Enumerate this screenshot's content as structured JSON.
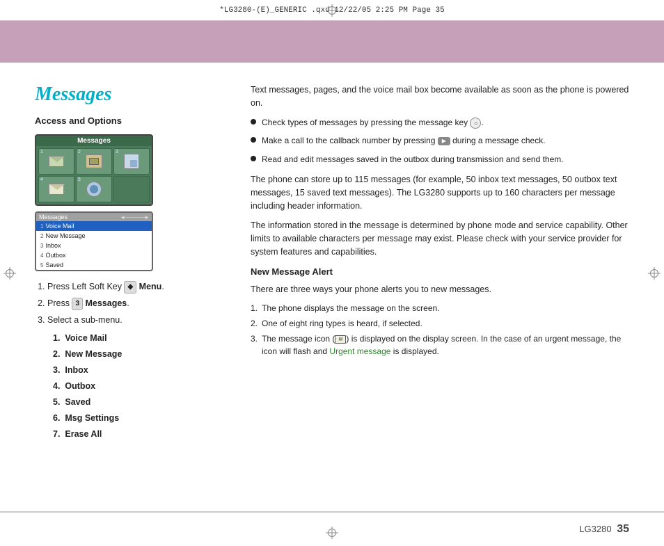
{
  "print_header": {
    "text": "*LG3280-(E)_GENERIC .qxd   12/22/05   2:25 PM   Page 35"
  },
  "color_band": {
    "color": "#c6a0b8"
  },
  "left_col": {
    "section_title": "Messages",
    "access_options_title": "Access and Options",
    "phone_top": {
      "header": "Messages",
      "cells": [
        {
          "num": "1",
          "type": "icon"
        },
        {
          "num": "2",
          "type": "icon"
        },
        {
          "num": "3",
          "type": "icon"
        },
        {
          "num": "4",
          "type": "icon"
        },
        {
          "num": "5",
          "type": "icon"
        }
      ]
    },
    "phone_bottom": {
      "header": "Messages",
      "menu_items": [
        {
          "num": "1",
          "label": "Voice Mail",
          "selected": true
        },
        {
          "num": "2",
          "label": "New Message"
        },
        {
          "num": "3",
          "label": "Inbox"
        },
        {
          "num": "4",
          "label": "Outbox"
        },
        {
          "num": "5",
          "label": "Saved"
        }
      ]
    },
    "steps": {
      "step1": "Press Left Soft Key",
      "step1_key": "Menu",
      "step2": "Press",
      "step2_key": "3",
      "step2_label": "Messages",
      "step3": "Select a sub-menu.",
      "sub_items": [
        {
          "num": "1.",
          "label": "Voice Mail"
        },
        {
          "num": "2.",
          "label": "New Message"
        },
        {
          "num": "3.",
          "label": "Inbox"
        },
        {
          "num": "4.",
          "label": "Outbox"
        },
        {
          "num": "5.",
          "label": "Saved"
        },
        {
          "num": "6.",
          "label": "Msg Settings"
        },
        {
          "num": "7.",
          "label": "Erase All"
        }
      ]
    }
  },
  "right_col": {
    "intro": "Text messages, pages, and the voice mail box become available as soon as the phone is powered on.",
    "bullets": [
      "Check types of messages by pressing the message key       .",
      "Make a call to the callback number by pressing        during a message check.",
      "Read and edit messages saved in the outbox during transmission and send them."
    ],
    "body1": "The phone can store up to 115 messages (for example, 50 inbox text messages, 50 outbox text messages, 15 saved text messages). The LG3280 supports up to 160 characters per message including header information.",
    "body2": "The information stored in the message is determined by phone mode and service capability. Other limits to available characters per message may exist. Please check with your service provider for system features and capabilities.",
    "alert_title": "New Message Alert",
    "alert_intro": "There are three ways your phone alerts you to new messages.",
    "alert_items": [
      {
        "num": "1.",
        "text": "The phone displays the message on the screen."
      },
      {
        "num": "2.",
        "text": "One of eight ring types is heard, if selected."
      },
      {
        "num": "3.",
        "text": "The message icon (      ) is displayed on the display screen. In the case of an urgent message, the icon will flash and Urgent message is displayed."
      }
    ],
    "urgent_text": "Urgent message"
  },
  "footer": {
    "brand": "LG3280",
    "page": "35"
  }
}
